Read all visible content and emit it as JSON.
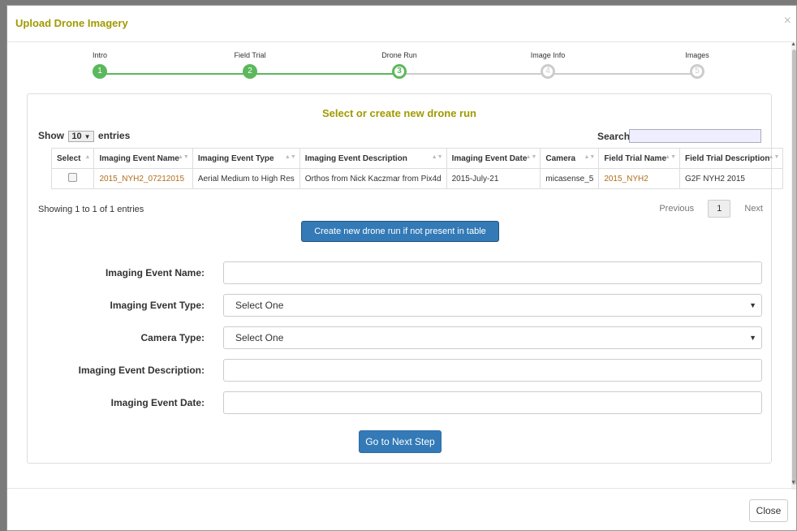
{
  "modal": {
    "title": "Upload Drone Imagery",
    "close_symbol": "×",
    "close_button": "Close"
  },
  "wizard": {
    "steps": [
      {
        "label": "Intro",
        "number": "1",
        "state": "done"
      },
      {
        "label": "Field Trial",
        "number": "2",
        "state": "done"
      },
      {
        "label": "Drone Run",
        "number": "3",
        "state": "active"
      },
      {
        "label": "Image Info",
        "number": "4",
        "state": "todo"
      },
      {
        "label": "Images",
        "number": "5",
        "state": "todo"
      }
    ]
  },
  "panel": {
    "title": "Select or create new drone run",
    "show_prefix": "Show",
    "show_value": "10",
    "show_suffix": "entries",
    "search_label": "Search:",
    "search_value": ""
  },
  "table": {
    "headers": [
      "Select",
      "Imaging Event Name",
      "Imaging Event Type",
      "Imaging Event Description",
      "Imaging Event Date",
      "Camera",
      "Field Trial Name",
      "Field Trial Description"
    ],
    "rows": [
      [
        "",
        "2015_NYH2_07212015",
        "Aerial Medium to High Res",
        "Orthos from Nick Kaczmar from Pix4d",
        "2015-July-21",
        "micasense_5",
        "2015_NYH2",
        "G2F NYH2 2015"
      ]
    ]
  },
  "pagination": {
    "info": "Showing 1 to 1 of 1 entries",
    "previous": "Previous",
    "page": "1",
    "next": "Next"
  },
  "create_button": "Create new drone run if not present in table",
  "form": {
    "event_name_label": "Imaging Event Name:",
    "event_type_label": "Imaging Event Type:",
    "event_type_value": "Select One",
    "camera_type_label": "Camera Type:",
    "camera_type_value": "Select One",
    "description_label": "Imaging Event Description:",
    "date_label": "Imaging Event Date:"
  },
  "next_button": "Go to Next Step",
  "colors": {
    "accent": "#a09a00",
    "primary": "#337ab7",
    "success": "#5cb85c",
    "link": "#b06c1a"
  }
}
